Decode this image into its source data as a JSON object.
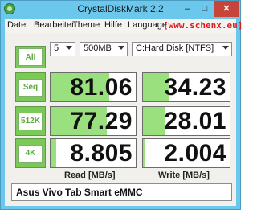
{
  "window": {
    "title": "CrystalDiskMark 2.2",
    "minimize_glyph": "–",
    "maximize_glyph": "□",
    "close_glyph": "✕"
  },
  "menu": {
    "items": [
      "Datei",
      "Bearbeiten",
      "Theme",
      "Hilfe",
      "Language"
    ],
    "watermark": "[www.schenx.eu]"
  },
  "controls": {
    "count": "5",
    "size": "500MB",
    "drive": "C:Hard Disk [NTFS]"
  },
  "buttons": {
    "all": "All",
    "seq": "Seq",
    "k512": "512K",
    "k4": "4K"
  },
  "results": {
    "seq": {
      "read": "81.06",
      "write": "34.23"
    },
    "k512": {
      "read": "77.29",
      "write": "28.01"
    },
    "k4": {
      "read": "8.805",
      "write": "2.004"
    }
  },
  "bar_fraction": {
    "seq": {
      "read": 0.69,
      "write": 0.3
    },
    "k512": {
      "read": 0.66,
      "write": 0.25
    },
    "k4": {
      "read": 0.07,
      "write": 0.02
    }
  },
  "labels": {
    "read": "Read [MB/s]",
    "write": "Write [MB/s]"
  },
  "comment": "Asus Vivo Tab Smart eMMC",
  "colors": {
    "frame": "#6bc8ec",
    "bar_fill": "#9ae07e",
    "button_green": "#7bca58",
    "watermark_red": "#e0191d",
    "close_red": "#c7443b"
  }
}
